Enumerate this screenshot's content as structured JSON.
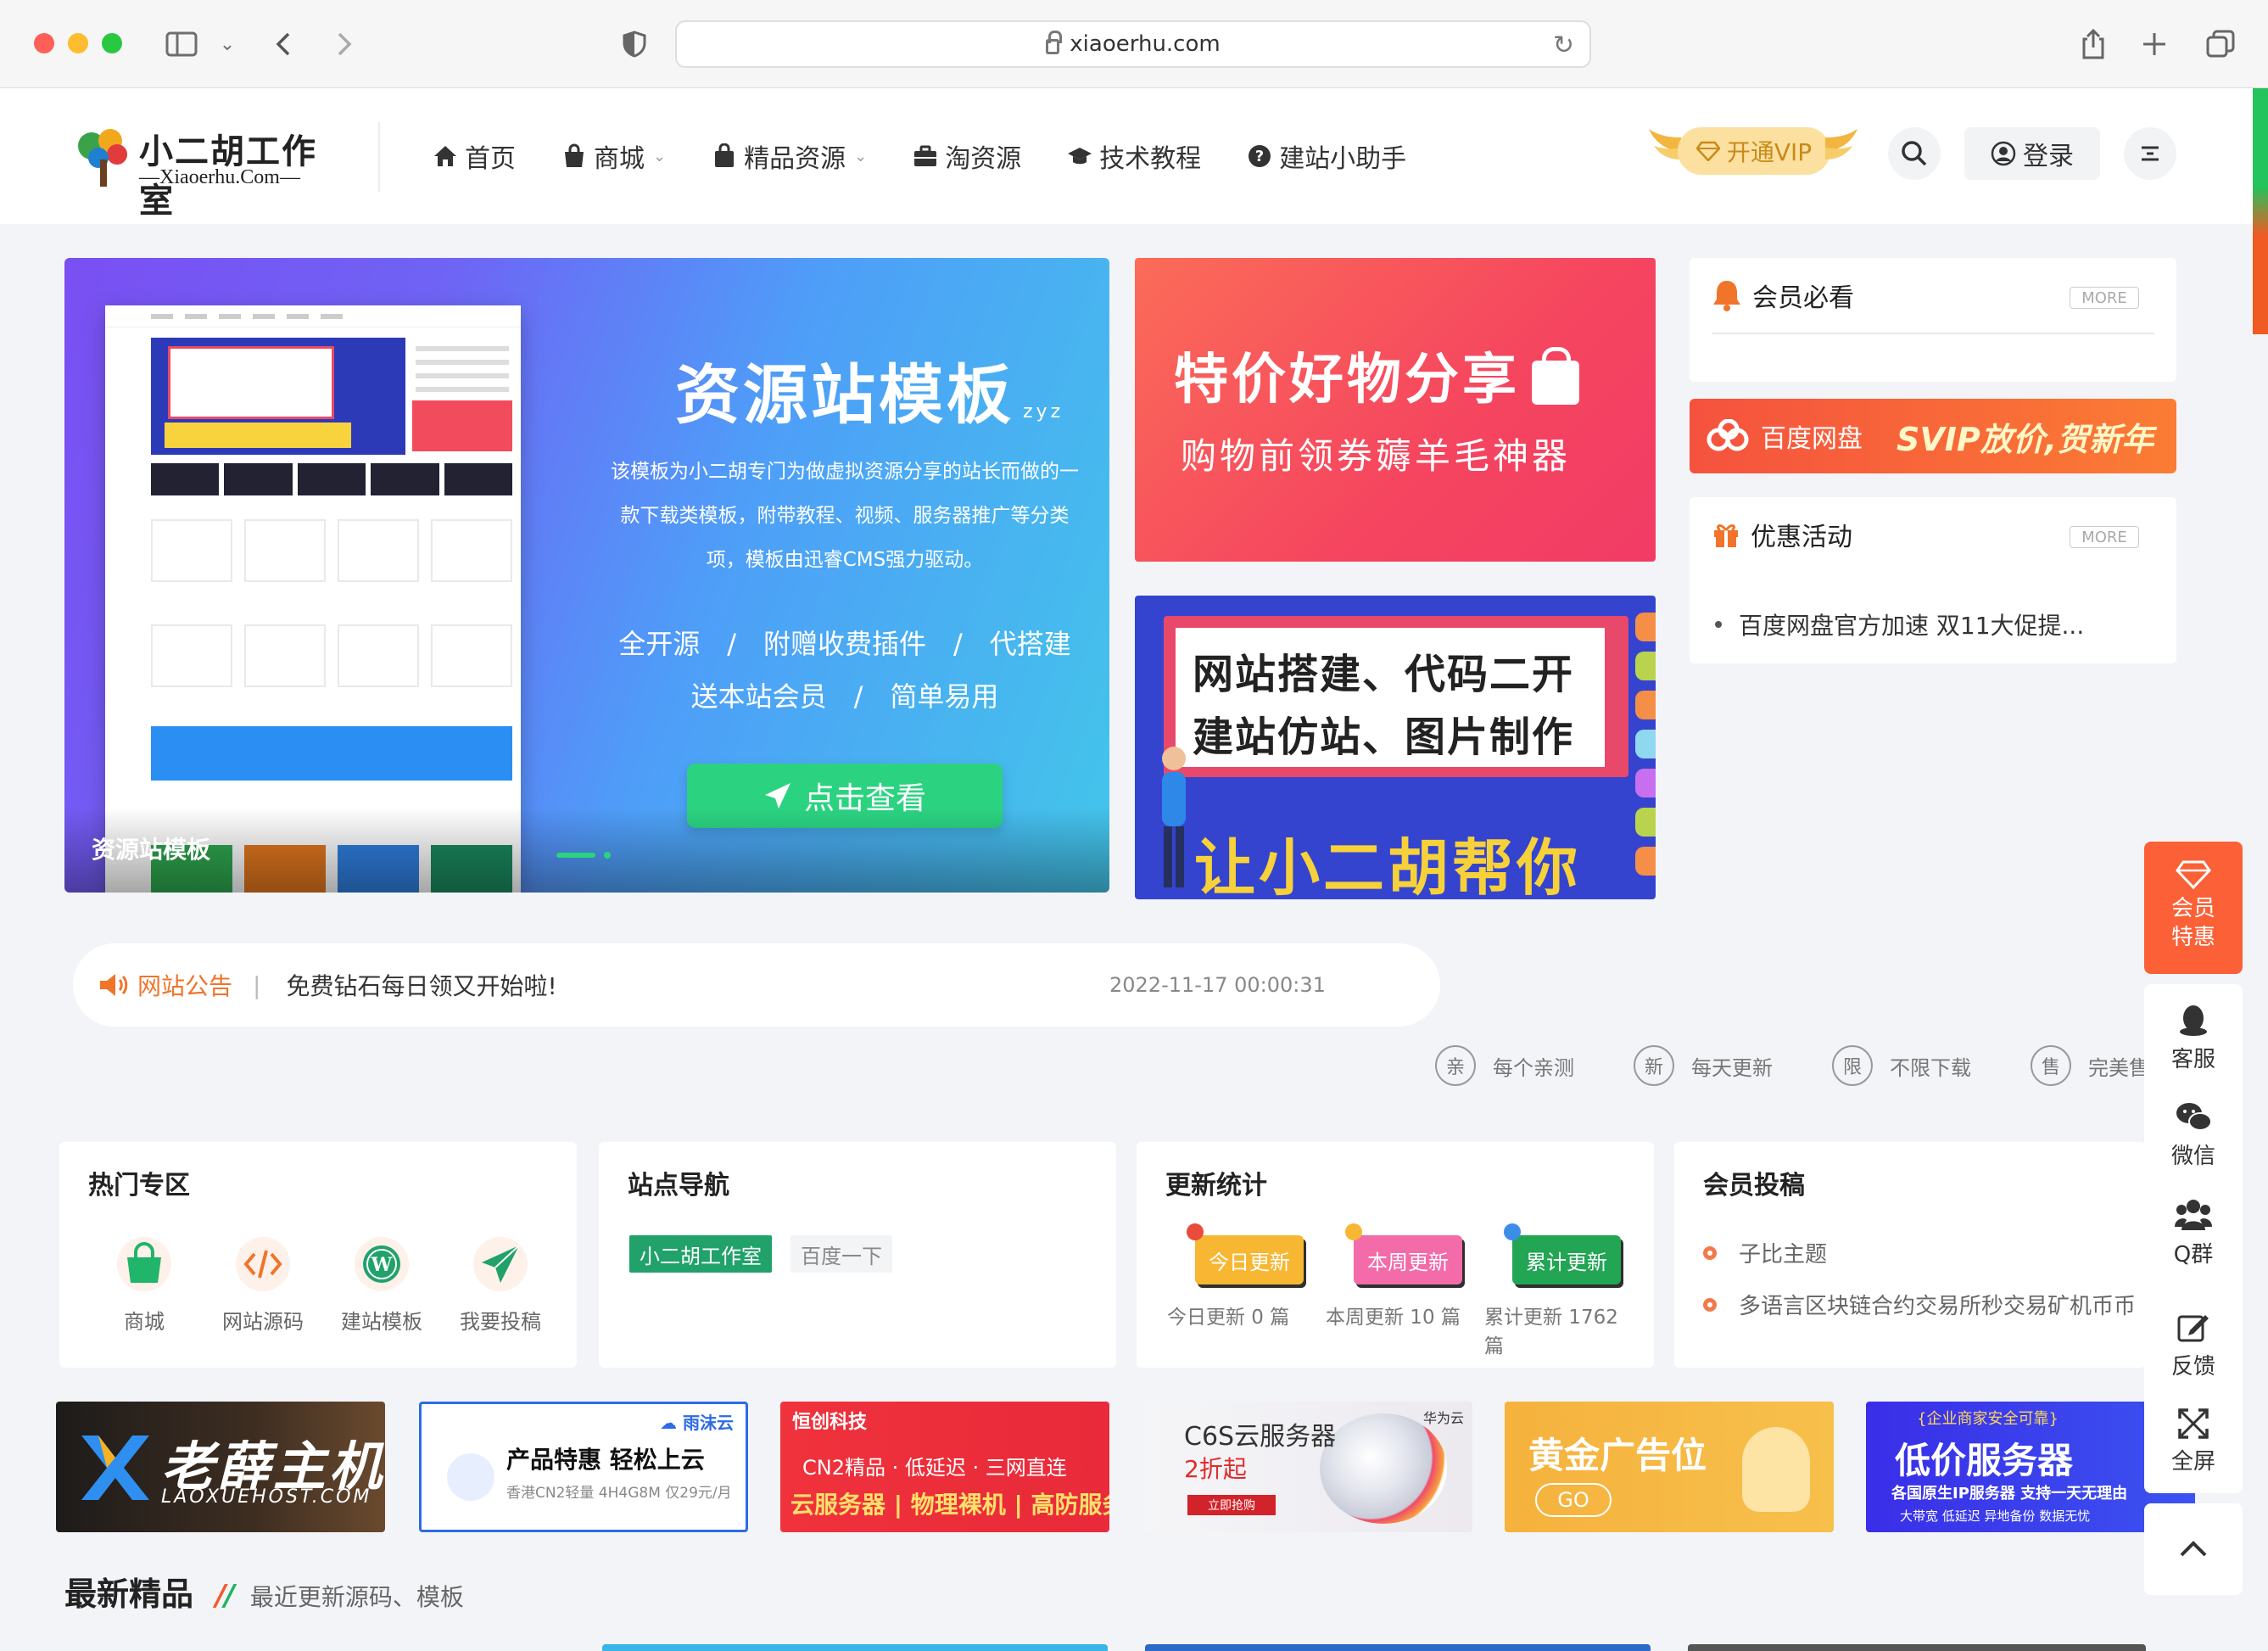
{
  "browser": {
    "url": "xiaoerhu.com"
  },
  "header": {
    "logo": {
      "title": "小二胡工作室",
      "subtitle": "—Xiaoerhu.Com—"
    },
    "nav": [
      {
        "label": "首页"
      },
      {
        "label": "商城"
      },
      {
        "label": "精品资源"
      },
      {
        "label": "淘资源"
      },
      {
        "label": "技术教程"
      },
      {
        "label": "建站小助手"
      }
    ],
    "vip_label": "开通VIP",
    "login_label": "登录"
  },
  "slider": {
    "title": "资源站模板",
    "title_suffix": "zyz",
    "description": "该模板为小二胡专门为做虚拟资源分享的站长而做的一款下载类模板，附带教程、视频、服务器推广等分类项，模板由迅睿CMS强力驱动。",
    "tags_line1": "全开源　/　附赠收费插件　/　代搭建",
    "tags_line2": "送本站会员　/　简单易用",
    "button": "点击查看",
    "caption": "资源站模板"
  },
  "promo1": {
    "title": "特价好物分享",
    "subtitle": "购物前领券薅羊毛神器"
  },
  "promo2": {
    "line1": "网站搭建、代码二开",
    "line2": "建站仿站、图片制作",
    "bottom": "让小二胡帮你"
  },
  "sidebar": {
    "member_title": "会员必看",
    "more": "MORE",
    "baidu_name": "百度网盘",
    "baidu_slogan": "SVIP放价,贺新年",
    "activity_title": "优惠活动",
    "activity_items": [
      "百度网盘官方加速 双11大促提..."
    ]
  },
  "notice": {
    "label": "网站公告",
    "separator": "|",
    "text": "免费钻石每日领又开始啦!",
    "date": "2022-11-17 00:00:31"
  },
  "features": [
    {
      "badge": "亲",
      "text": "每个亲测"
    },
    {
      "badge": "新",
      "text": "每天更新"
    },
    {
      "badge": "限",
      "text": "不限下载"
    },
    {
      "badge": "售",
      "text": "完美售"
    }
  ],
  "hot_zone": {
    "title": "热门专区",
    "items": [
      {
        "label": "商城",
        "icon": "shopping-bag-icon",
        "color": "#20b56a"
      },
      {
        "label": "网站源码",
        "icon": "code-icon",
        "color": "#f0742a"
      },
      {
        "label": "建站模板",
        "icon": "wordpress-icon",
        "color": "#20a26a"
      },
      {
        "label": "我要投稿",
        "icon": "paper-plane-icon",
        "color": "#20a26a"
      }
    ]
  },
  "site_nav": {
    "title": "站点导航",
    "links": [
      "小二胡工作室",
      "百度一下"
    ]
  },
  "update_stats": {
    "title": "更新统计",
    "items": [
      {
        "flag": "今日更新",
        "text": "今日更新 0 篇",
        "color": "#f7b733"
      },
      {
        "flag": "本周更新",
        "text": "本周更新 10 篇",
        "color": "#f36ba8"
      },
      {
        "flag": "累计更新",
        "text": "累计更新 1762 篇",
        "color": "#22a654"
      }
    ]
  },
  "contributions": {
    "title": "会员投稿",
    "items": [
      "子比主题",
      "多语言区块链合约交易所秒交易矿机币币"
    ]
  },
  "ads": {
    "ad1": {
      "title": "老薛主机",
      "sub": "LAOXUEHOST.COM"
    },
    "ad2": {
      "brand": "雨沫云",
      "title": "产品特惠 轻松上云",
      "sub": "香港CN2轻量 4H4G8M 仅29元/月"
    },
    "ad3": {
      "brand": "恒创科技",
      "line1": "CN2精品 · 低延迟 · 三网直连",
      "line2": "云服务器 | 物理裸机 | 高防服务器"
    },
    "ad4": {
      "title": "C6S云服务器",
      "price": "2折起",
      "button": "立即抢购",
      "brand": "华为云"
    },
    "ad5": {
      "title": "黄金广告位",
      "button": "GO"
    },
    "ad6": {
      "top": "{企业商家安全可靠}",
      "title": "低价服务器",
      "line1": "各国原生IP服务器 支持一天无理由",
      "line2": "大带宽 低延迟 异地备份 数据无忧"
    }
  },
  "latest": {
    "title": "最新精品",
    "subtitle": "最近更新源码、模板"
  },
  "float_bar": {
    "vip": "会员特惠",
    "items": [
      "客服",
      "微信",
      "Q群",
      "反馈",
      "全屏"
    ]
  }
}
